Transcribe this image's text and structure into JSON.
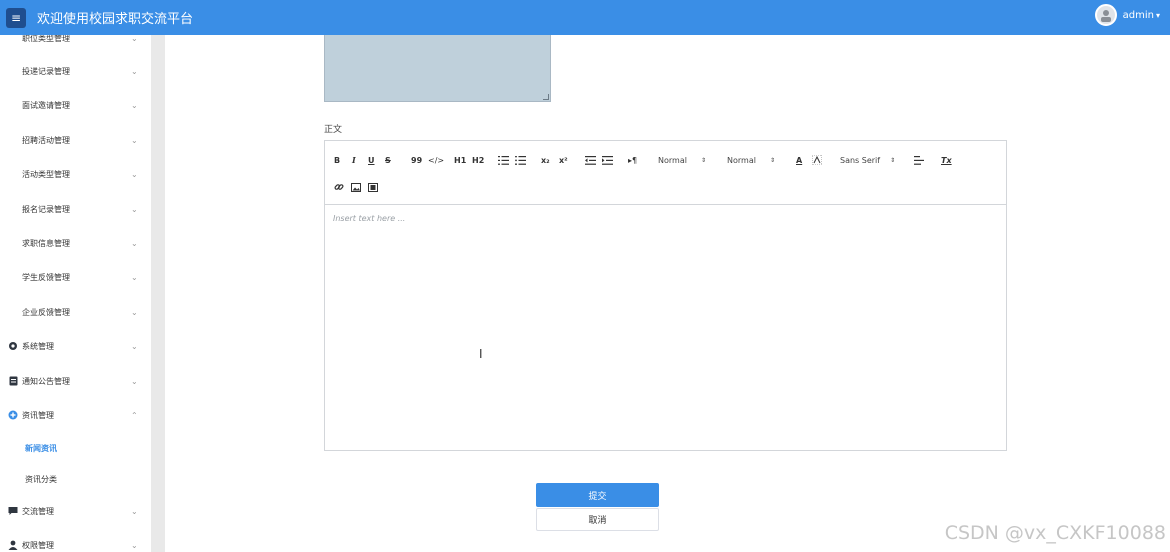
{
  "header": {
    "title": "欢迎使用校园求职交流平台",
    "menu_icon": "≡",
    "user": "admin",
    "caret": "▾"
  },
  "sidebar": {
    "items": [
      {
        "label": "职位类型管理",
        "icon": "grid-icon",
        "arrow": "⌄"
      },
      {
        "label": "投递记录管理",
        "icon": "grid-icon",
        "arrow": "⌄"
      },
      {
        "label": "面试邀请管理",
        "icon": "grid-icon",
        "arrow": "⌄"
      },
      {
        "label": "招聘活动管理",
        "icon": "grid-icon",
        "arrow": "⌄"
      },
      {
        "label": "活动类型管理",
        "icon": "grid-icon",
        "arrow": "⌄"
      },
      {
        "label": "报名记录管理",
        "icon": "grid-icon",
        "arrow": "⌄"
      },
      {
        "label": "求职信息管理",
        "icon": "grid-icon",
        "arrow": "⌄"
      },
      {
        "label": "学生反馈管理",
        "icon": "grid-icon",
        "arrow": "⌄"
      },
      {
        "label": "企业反馈管理",
        "icon": "grid-icon",
        "arrow": "⌄"
      },
      {
        "label": "系统管理",
        "icon": "gear-icon",
        "arrow": "⌄"
      },
      {
        "label": "通知公告管理",
        "icon": "document-icon",
        "arrow": "⌄"
      },
      {
        "label": "资讯管理",
        "icon": "plus-circle-icon",
        "arrow": "⌃"
      },
      {
        "label": "交流管理",
        "icon": "chat-icon",
        "arrow": "⌄"
      },
      {
        "label": "权限管理",
        "icon": "user-icon",
        "arrow": "⌄"
      }
    ],
    "subitems": [
      {
        "label": "新闻资讯",
        "active": true
      },
      {
        "label": "资讯分类",
        "active": false
      }
    ]
  },
  "form": {
    "content_label": "正文",
    "placeholder": "Insert text here ...",
    "submit": "提交",
    "cancel": "取消"
  },
  "toolbar": {
    "bold": "B",
    "italic": "I",
    "underline": "U",
    "strike": "S",
    "quote": "99",
    "code": "</>",
    "h1": "H1",
    "h2": "H2",
    "sub": "x₂",
    "sup": "x²",
    "rtl": "▸¶",
    "size": "Normal",
    "header": "Normal",
    "color": "A",
    "font": "Sans Serif",
    "align": "≡",
    "clean": "Tx",
    "select_caret": "⇕"
  },
  "watermark": "CSDN @vx_CXKF10088",
  "colors": {
    "header": "#3a8ee6",
    "primary_button": "#3a8ee6",
    "textarea": "#bfd0db"
  }
}
